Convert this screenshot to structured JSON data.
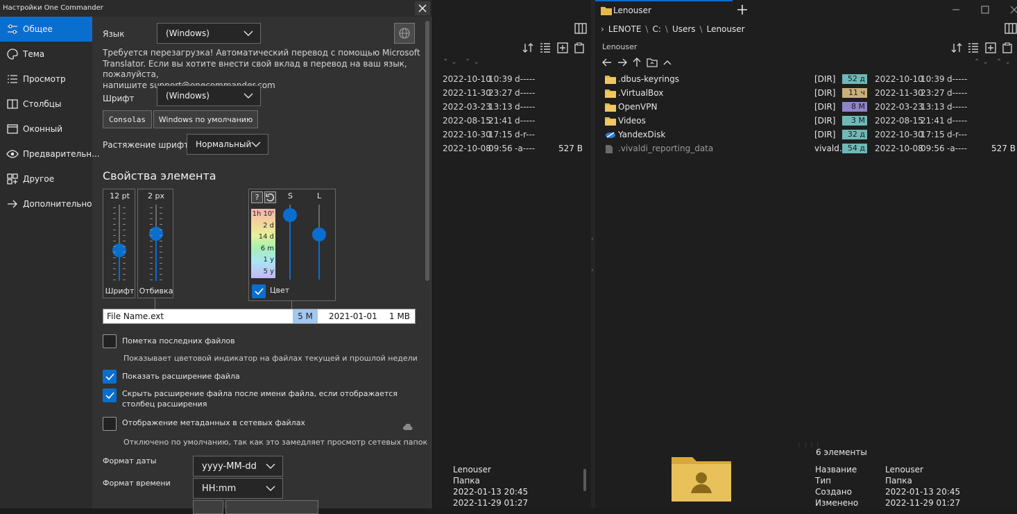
{
  "settings": {
    "title": "Настройки One Commander",
    "sidebar": [
      {
        "label": "Общее",
        "icon": "sliders-icon",
        "active": true
      },
      {
        "label": "Тема",
        "icon": "palette-icon"
      },
      {
        "label": "Просмотр",
        "icon": "list-icon"
      },
      {
        "label": "Столбцы",
        "icon": "columns-icon"
      },
      {
        "label": "Оконный",
        "icon": "window-icon"
      },
      {
        "label": "Предварительн...",
        "icon": "eye-icon"
      },
      {
        "label": "Другое",
        "icon": "grid-plus-icon"
      },
      {
        "label": "Дополнительно",
        "icon": "arrow-right-icon"
      }
    ],
    "language_label": "Язык",
    "language_value": "(Windows)",
    "restart_note": "Требуется перезагрузка! Автоматический перевод с помощью Microsoft Translator. Если вы хотите внести свой вклад в перевод на ваш язык, пожалуйста, напишите support@onecommander.com",
    "restart_note_lines": [
      "Требуется перезагрузка! Автоматический перевод с помощью Microsoft",
      "Translator. Если вы хотите внести свой вклад в перевод на ваш язык, пожалуйста,",
      "напишите support@onecommander.com"
    ],
    "font_label": "Шрифт",
    "font_value": "(Windows)",
    "font_btn_consolas": "Consolas",
    "font_btn_default": "Windows по умолчанию",
    "stretch_label": "Растяжение шрифта",
    "stretch_value": "Нормальный",
    "item_props_title": "Свойства элемента",
    "font_size": "12 pt",
    "font_size_caption": "Шрифт",
    "padding": "2 px",
    "padding_caption": "Отбивка",
    "font_size_level": 0.4,
    "padding_level": 0.62,
    "saturation_label": "S",
    "lightness_label": "L",
    "saturation_level": 0.86,
    "lightness_level": 0.6,
    "age_scale": [
      "1h 10'",
      "2 d",
      "14 d",
      "6 m",
      "1 y",
      "5 y"
    ],
    "color_label": "Цвет",
    "preview": {
      "name": "File Name.ext",
      "age": "5 M",
      "date": "2021-01-01",
      "size": "1 MB"
    },
    "options": [
      {
        "label": "Пометка последних файлов",
        "checked": false,
        "hint": "Показывает цветовой индикатор на файлах текущей и прошлой недели"
      },
      {
        "label": "Показать расширение файла",
        "checked": true
      },
      {
        "label": "Скрыть расширение файла после имени файла, если отображается",
        "label2": "столбец расширения",
        "checked": true
      },
      {
        "label": "Отображение метаданных в сетевых файлах",
        "checked": false,
        "hint": "Отключено по умолчанию, так как это замедляет просмотр сетевых папок"
      }
    ],
    "date_format_label": "Формат даты",
    "date_format_value": "yyyy-MM-dd",
    "time_format_label": "Формат времени",
    "time_format_value": "HH:mm"
  },
  "filemanager": {
    "tab_title": "Lenouser",
    "breadcrumb": [
      "LENOTE",
      "C:",
      "Users",
      "Lenouser"
    ],
    "pane_title": "Lenouser",
    "left_rows": [
      {
        "date": "2022-10-10",
        "time": "10:39",
        "attr": "d-----",
        "size": ""
      },
      {
        "date": "2022-11-30",
        "time": "23:27",
        "attr": "d-----",
        "size": ""
      },
      {
        "date": "2022-03-23",
        "time": "13:13",
        "attr": "d-----",
        "size": ""
      },
      {
        "date": "2022-08-15",
        "time": "21:41",
        "attr": "d-----",
        "size": ""
      },
      {
        "date": "2022-10-30",
        "time": "17:15",
        "attr": "d-r---",
        "size": ""
      },
      {
        "date": "2022-10-08",
        "time": "09:56",
        "attr": "-a----",
        "size": "527 B"
      }
    ],
    "right_rows": [
      {
        "name": ".dbus-keyrings",
        "type": "[DIR]",
        "age": "52 д",
        "age_color": "#6fb8b8",
        "date": "2022-10-10",
        "time": "10:39",
        "attr": "d-----",
        "size": "",
        "icon": "folder-icon"
      },
      {
        "name": ".VirtualBox",
        "type": "[DIR]",
        "age": "11 ч",
        "age_color": "#c8b07a",
        "date": "2022-11-30",
        "time": "23:27",
        "attr": "d-----",
        "size": "",
        "icon": "folder-icon"
      },
      {
        "name": "OpenVPN",
        "type": "[DIR]",
        "age": "8 М",
        "age_color": "#8f86c8",
        "date": "2022-03-23",
        "time": "13:13",
        "attr": "d-----",
        "size": "",
        "icon": "folder-icon"
      },
      {
        "name": "Videos",
        "type": "[DIR]",
        "age": "3 М",
        "age_color": "#6fb8b8",
        "date": "2022-08-15",
        "time": "21:41",
        "attr": "d-----",
        "size": "",
        "icon": "folder-icon"
      },
      {
        "name": "YandexDisk",
        "type": "[DIR]",
        "age": "32 д",
        "age_color": "#6fb8b8",
        "date": "2022-10-30",
        "time": "17:15",
        "attr": "d-r---",
        "size": "",
        "icon": "yandex-disk-icon"
      },
      {
        "name": ".vivaldi_reporting_data",
        "type": "vivald...",
        "age": "54 д",
        "age_color": "#6fb8b8",
        "date": "2022-10-08",
        "time": "09:56",
        "attr": "-a----",
        "size": "527 B",
        "icon": "file-icon"
      }
    ],
    "left_footer": {
      "name": "Lenouser",
      "type": "Папка",
      "created": "2022-01-13  20:45",
      "modified": "2022-11-29  01:27"
    },
    "right_footer": {
      "count": "6 элементы",
      "props": [
        {
          "key": "Название",
          "value": "Lenouser"
        },
        {
          "key": "Тип",
          "value": "Папка"
        },
        {
          "key": "Создано",
          "value": "2022-01-13  20:45"
        },
        {
          "key": "Изменено",
          "value": "2022-11-29  01:27"
        }
      ]
    }
  }
}
